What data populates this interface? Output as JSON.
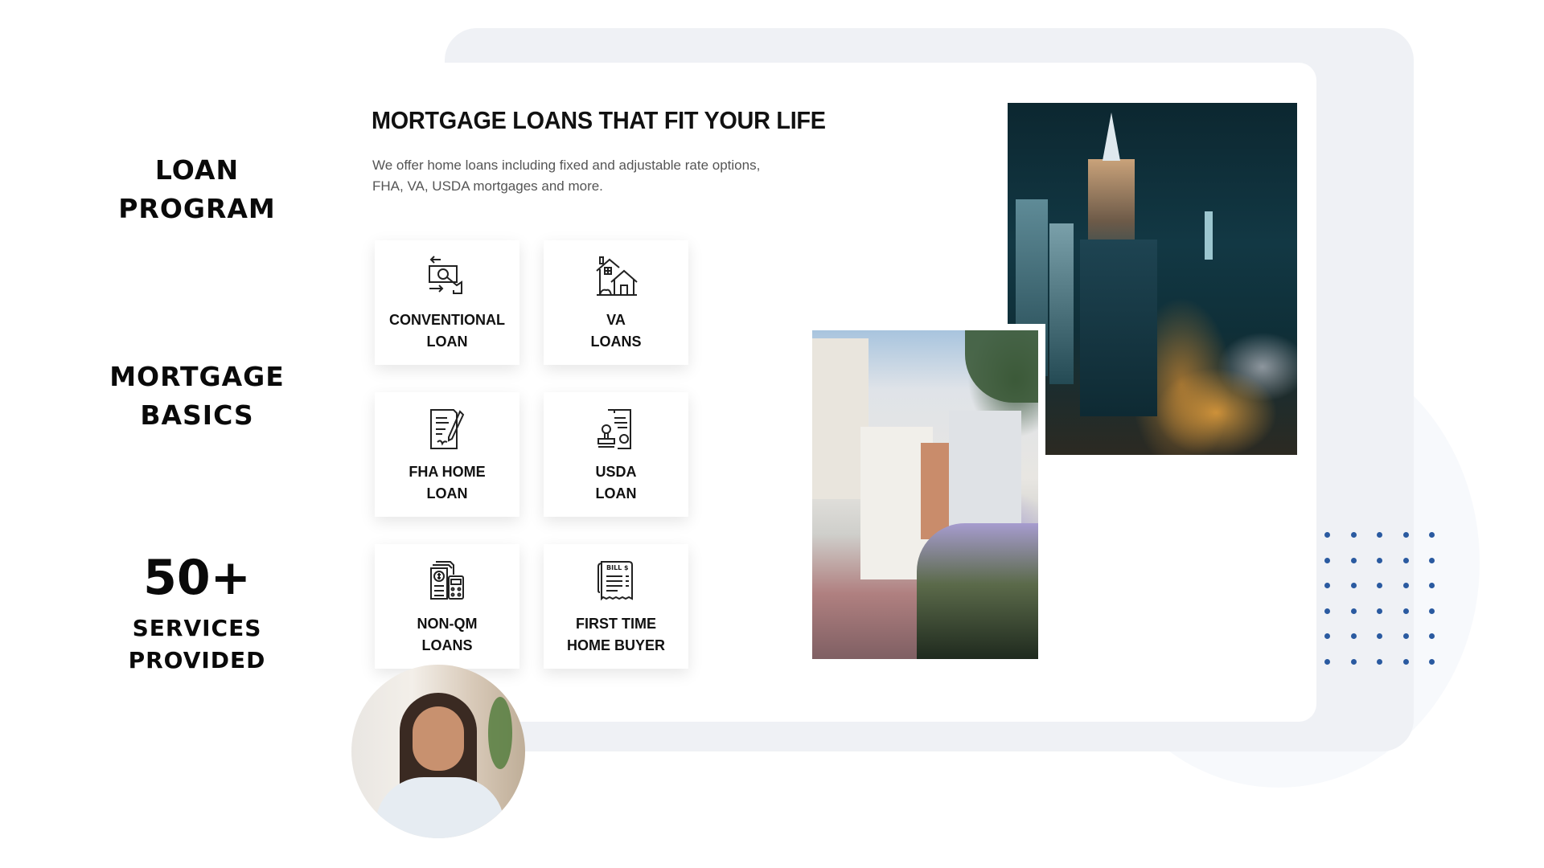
{
  "side_labels": {
    "loan_program": [
      "LOAN",
      "PROGRAM"
    ],
    "mortgage_basics": [
      "MORTGAGE",
      "BASICS"
    ],
    "stat_value": "50+",
    "stat_label": [
      "SERVICES",
      "PROVIDED"
    ]
  },
  "main": {
    "heading": "MORTGAGE LOANS THAT FIT YOUR LIFE",
    "subtitle": "We offer home loans including fixed and adjustable rate options, FHA, VA, USDA mortgages and more."
  },
  "loan_cards": [
    {
      "icon": "money-exchange-icon",
      "lines": [
        "CONVENTIONAL",
        "LOAN"
      ]
    },
    {
      "icon": "houses-icon",
      "lines": [
        "VA",
        "LOANS"
      ]
    },
    {
      "icon": "contract-pen-icon",
      "lines": [
        "FHA HOME",
        "LOAN"
      ]
    },
    {
      "icon": "stamp-document-icon",
      "lines": [
        "USDA",
        "LOAN"
      ]
    },
    {
      "icon": "calculator-document-icon",
      "lines": [
        "NON-QM",
        "LOANS"
      ]
    },
    {
      "icon": "bill-receipt-icon",
      "lines": [
        "FIRST TIME",
        "HOME BUYER"
      ],
      "icon_text": "BILL $"
    }
  ],
  "images": {
    "city": "night city skyline photo",
    "street": "residential street with hydrangeas photo",
    "avatar": "smiling woman portrait"
  },
  "colors": {
    "accent_dots": "#2a5aa0",
    "outer_card": "#eff1f5",
    "text": "#111111"
  }
}
